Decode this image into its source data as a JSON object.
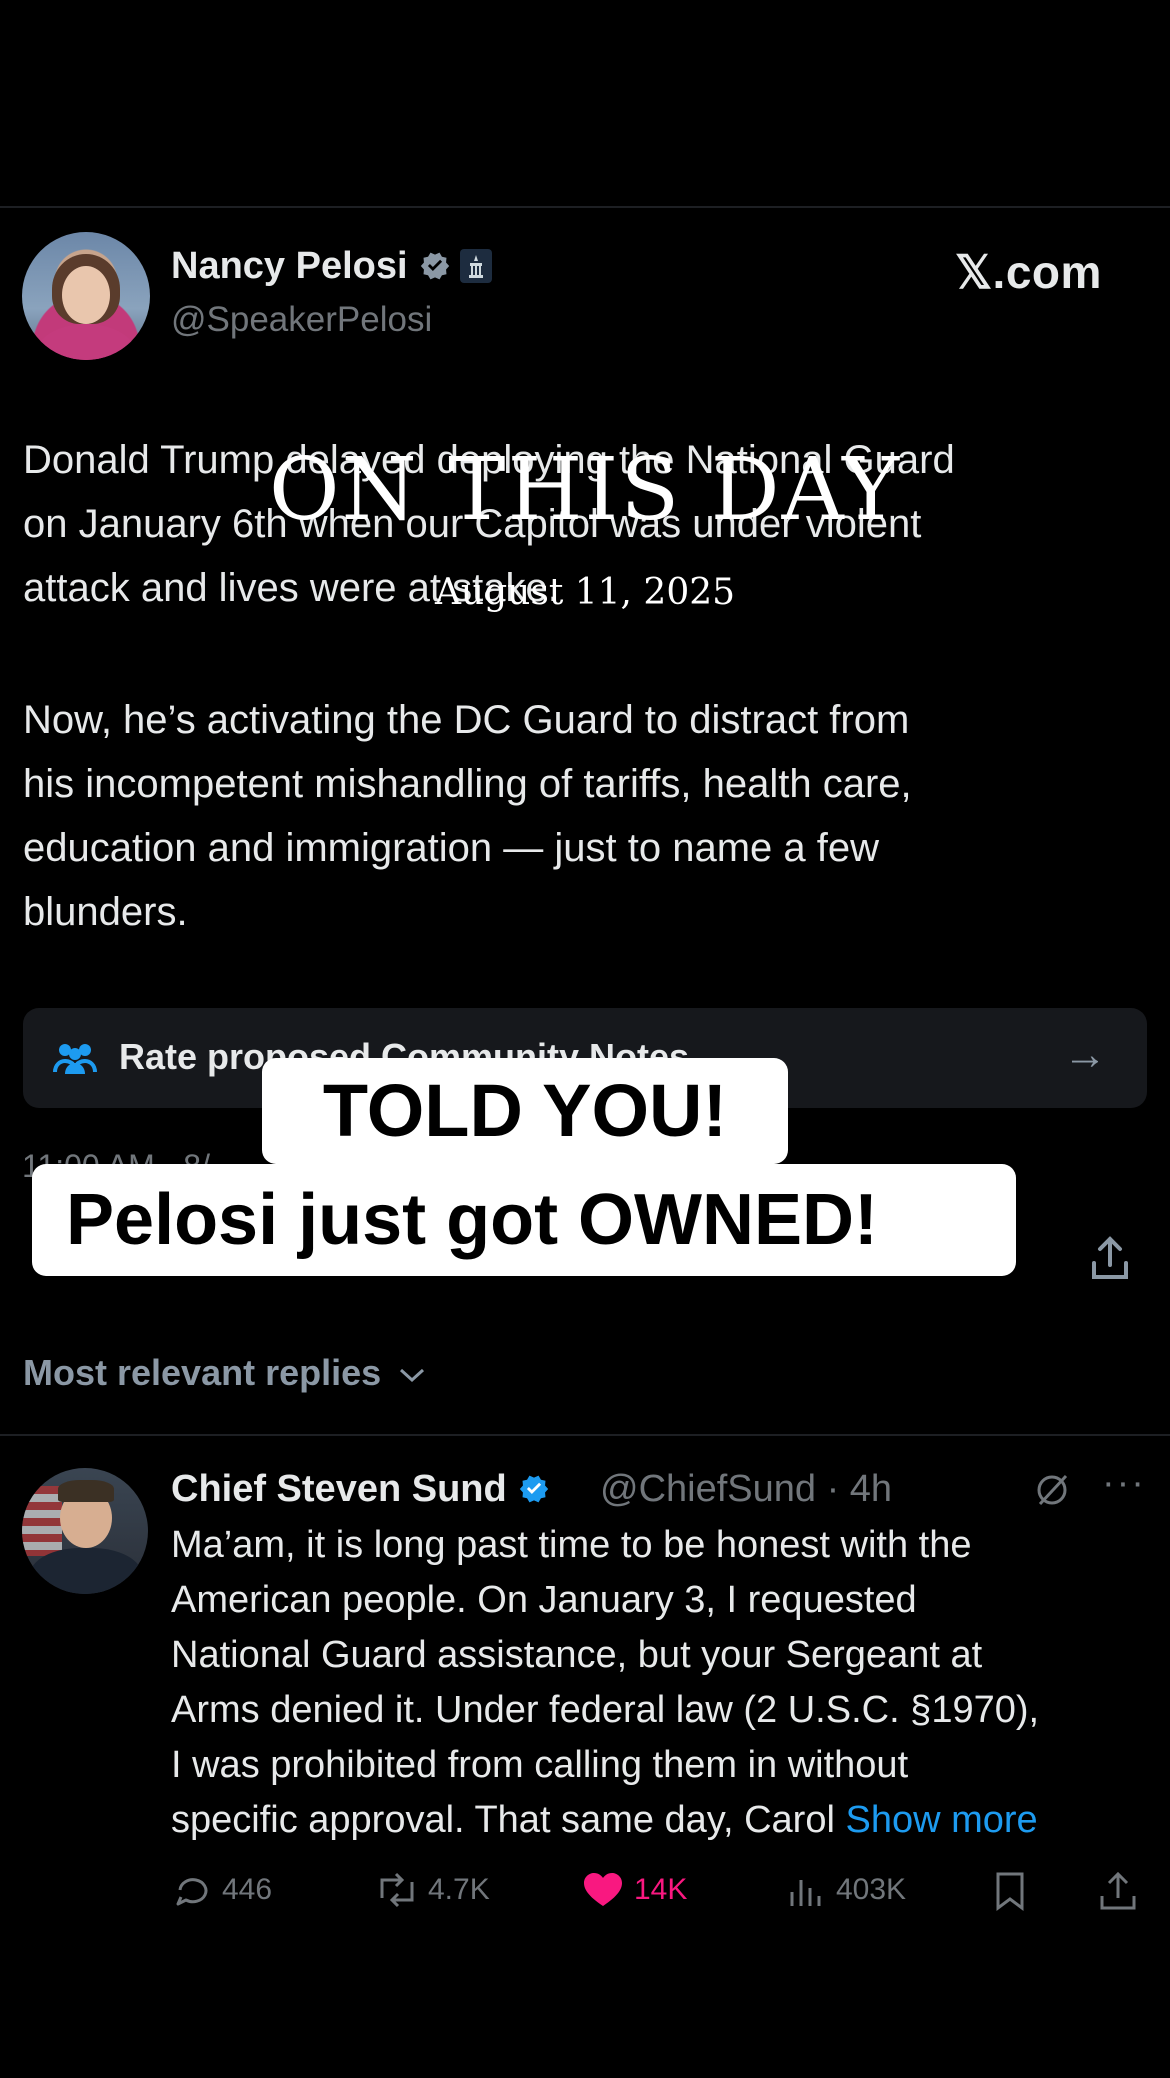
{
  "main_tweet": {
    "author_name": "Nancy Pelosi",
    "author_handle": "@SpeakerPelosi",
    "site_label": "𝕏.com",
    "paragraph1_lines": [
      "Donald Trump delayed deploying the National Guard",
      "on January 6th when our Capitol was under violent",
      "attack and lives were at stake."
    ],
    "paragraph2_lines": [
      "Now, he’s activating the DC Guard to distract from",
      "his incompetent mishandling of tariffs, health care,",
      "education and immigration — just to name a few",
      "blunders."
    ],
    "community_notes_label": "Rate proposed Community Notes",
    "meta_peek": "11:00 AM · 8/"
  },
  "overlay": {
    "title": "ON THIS DAY",
    "date": "August 11, 2025",
    "caption_line1": "TOLD YOU!",
    "caption_line2": "Pelosi just got OWNED!"
  },
  "replies_header": "Most relevant replies",
  "reply": {
    "author_name": "Chief Steven Sund",
    "author_handle_time": "@ChiefSund · 4h",
    "text_lines": [
      "Ma’am, it is long past time to be honest with the",
      "American people. On January 3, I requested",
      "National Guard assistance, but your Sergeant at",
      "Arms denied it. Under federal law (2 U.S.C. §1970),",
      "I was prohibited from calling them in without"
    ],
    "last_line_text": "specific approval. That same day, Carol",
    "show_more": "Show more",
    "stats": {
      "replies": "446",
      "reposts": "4.7K",
      "likes": "14K",
      "views": "403K"
    }
  },
  "colors": {
    "background": "#000000",
    "text": "#e7e9ea",
    "muted": "#71767b",
    "link": "#1d9bf0",
    "like": "#f91880"
  }
}
